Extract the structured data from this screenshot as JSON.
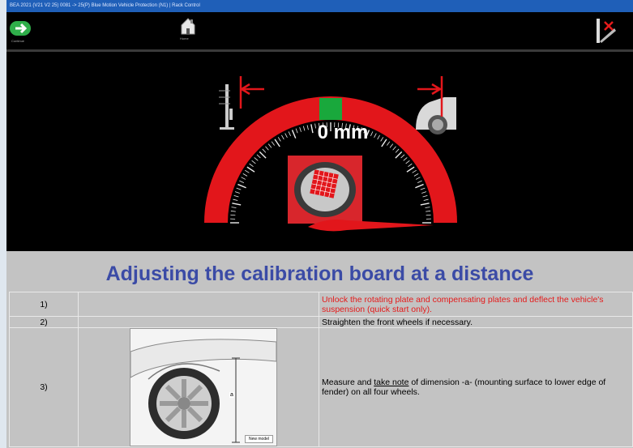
{
  "window": {
    "title": "BEA 2021 (V21 V2 25) 0081 -> 25(P) Blue Motion Vehicle Protection (N1)  |  Rack Control"
  },
  "toolbar": {
    "next_label": "Continue",
    "home_label": "Home",
    "exit_label": "Exit"
  },
  "gauge": {
    "readout": "0 mm",
    "value_mm": 0,
    "colors": {
      "arc": "#e2161b",
      "indicator": "#16a34a",
      "arrow": "#e2161b"
    }
  },
  "content": {
    "heading": "Adjusting the calibration board at a distance",
    "steps": [
      {
        "num": "1)",
        "text": "Unlock the rotating plate and compensating plates and deflect the vehicle's suspension (quick start only).",
        "color": "#e41b1b"
      },
      {
        "num": "2)",
        "text": "Straighten the front wheels if necessary."
      },
      {
        "num": "3)",
        "text_before": "Measure and ",
        "text_underlined": "take note",
        "text_after": " of dimension -a- (mounting surface to lower edge of fender) on all four wheels.",
        "image_label": "a",
        "image_caption": "New model"
      }
    ]
  }
}
